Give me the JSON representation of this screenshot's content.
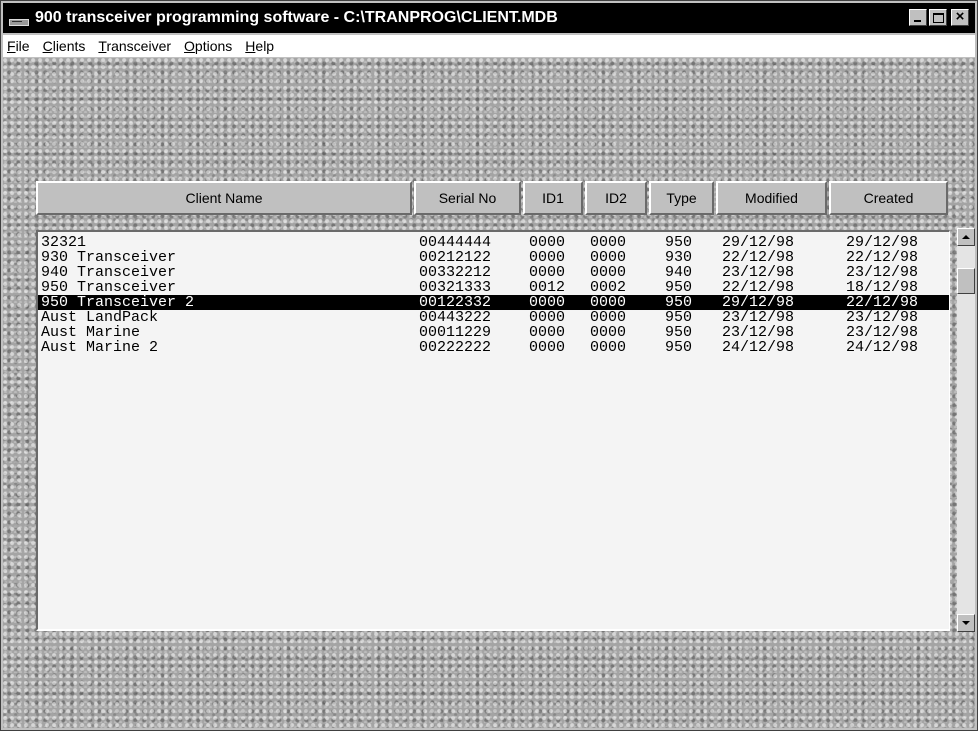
{
  "window": {
    "title": "900 transceiver programming software - C:\\TRANPROG\\CLIENT.MDB"
  },
  "menu": [
    {
      "mnemonic": "F",
      "rest": "ile"
    },
    {
      "mnemonic": "C",
      "rest": "lients"
    },
    {
      "mnemonic": "T",
      "rest": "ransceiver"
    },
    {
      "mnemonic": "O",
      "rest": "ptions"
    },
    {
      "mnemonic": "H",
      "rest": "elp"
    }
  ],
  "columns": [
    "Client Name",
    "Serial No",
    "ID1",
    "ID2",
    "Type",
    "Modified",
    "Created"
  ],
  "rows": [
    {
      "name": "32321",
      "serial": "00444444",
      "id1": "0000",
      "id2": "0000",
      "type": "950",
      "modified": "29/12/98",
      "created": "29/12/98"
    },
    {
      "name": "930 Transceiver",
      "serial": "00212122",
      "id1": "0000",
      "id2": "0000",
      "type": "930",
      "modified": "22/12/98",
      "created": "22/12/98"
    },
    {
      "name": "940 Transceiver",
      "serial": "00332212",
      "id1": "0000",
      "id2": "0000",
      "type": "940",
      "modified": "23/12/98",
      "created": "23/12/98"
    },
    {
      "name": "950 Transceiver",
      "serial": "00321333",
      "id1": "0012",
      "id2": "0002",
      "type": "950",
      "modified": "22/12/98",
      "created": "18/12/98"
    },
    {
      "name": "950 Transceiver 2",
      "serial": "00122332",
      "id1": "0000",
      "id2": "0000",
      "type": "950",
      "modified": "29/12/98",
      "created": "22/12/98"
    },
    {
      "name": "Aust LandPack",
      "serial": "00443222",
      "id1": "0000",
      "id2": "0000",
      "type": "950",
      "modified": "23/12/98",
      "created": "23/12/98"
    },
    {
      "name": "Aust Marine",
      "serial": "00011229",
      "id1": "0000",
      "id2": "0000",
      "type": "950",
      "modified": "23/12/98",
      "created": "23/12/98"
    },
    {
      "name": "Aust Marine 2",
      "serial": "00222222",
      "id1": "0000",
      "id2": "0000",
      "type": "950",
      "modified": "24/12/98",
      "created": "24/12/98"
    }
  ],
  "selected_row": 4,
  "colors": {
    "title_bar": "#000000",
    "selection": "#000000",
    "face": "#c0c0c0",
    "list_background": "#f4f4f4"
  }
}
